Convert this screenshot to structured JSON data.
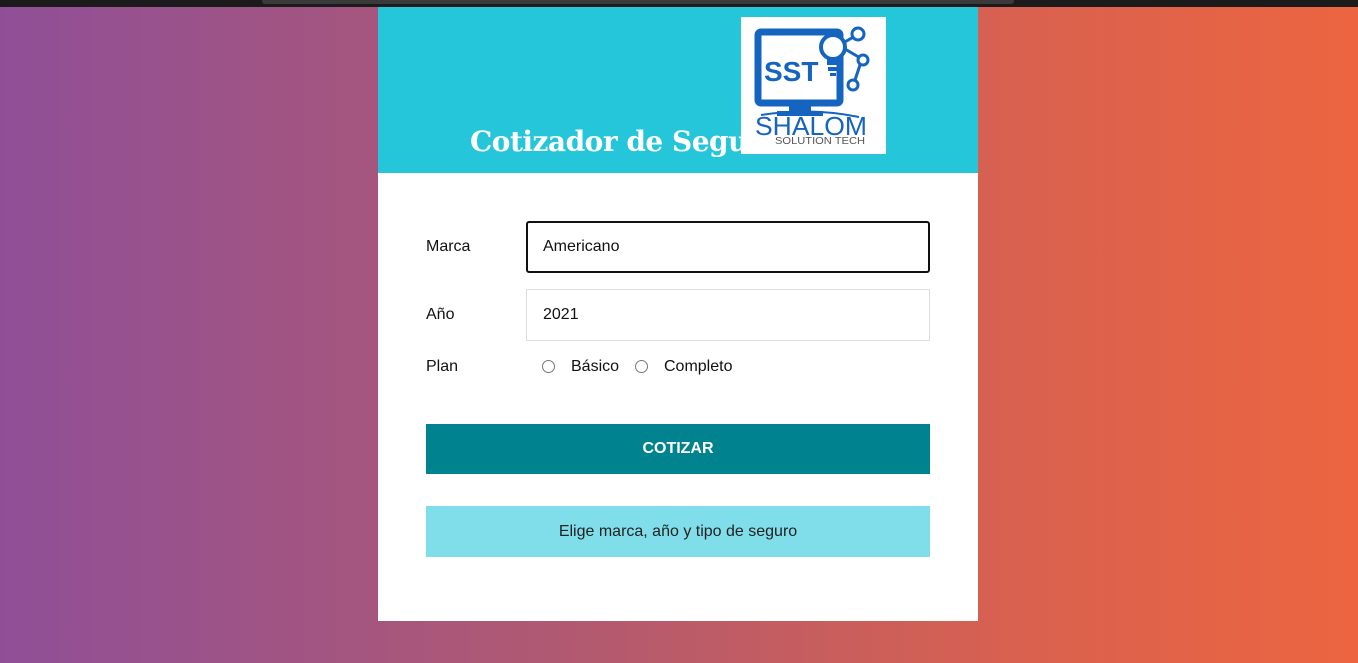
{
  "header": {
    "title": "Cotizador de Seguros",
    "logo_text": "SST",
    "logo_brand": "SHALOM",
    "logo_tagline": "SOLUTION TECH"
  },
  "form": {
    "brand": {
      "label": "Marca",
      "value": "Americano"
    },
    "year": {
      "label": "Año",
      "value": "2021"
    },
    "plan": {
      "label": "Plan",
      "options": [
        {
          "label": "Básico",
          "checked": false
        },
        {
          "label": "Completo",
          "checked": false
        }
      ]
    },
    "submit_label": "COTIZAR"
  },
  "message": "Elige marca, año y tipo de seguro",
  "colors": {
    "header_bg": "#26c6da",
    "button_bg": "#00838f",
    "message_bg": "#80deea",
    "logo_blue": "#1565c0"
  }
}
